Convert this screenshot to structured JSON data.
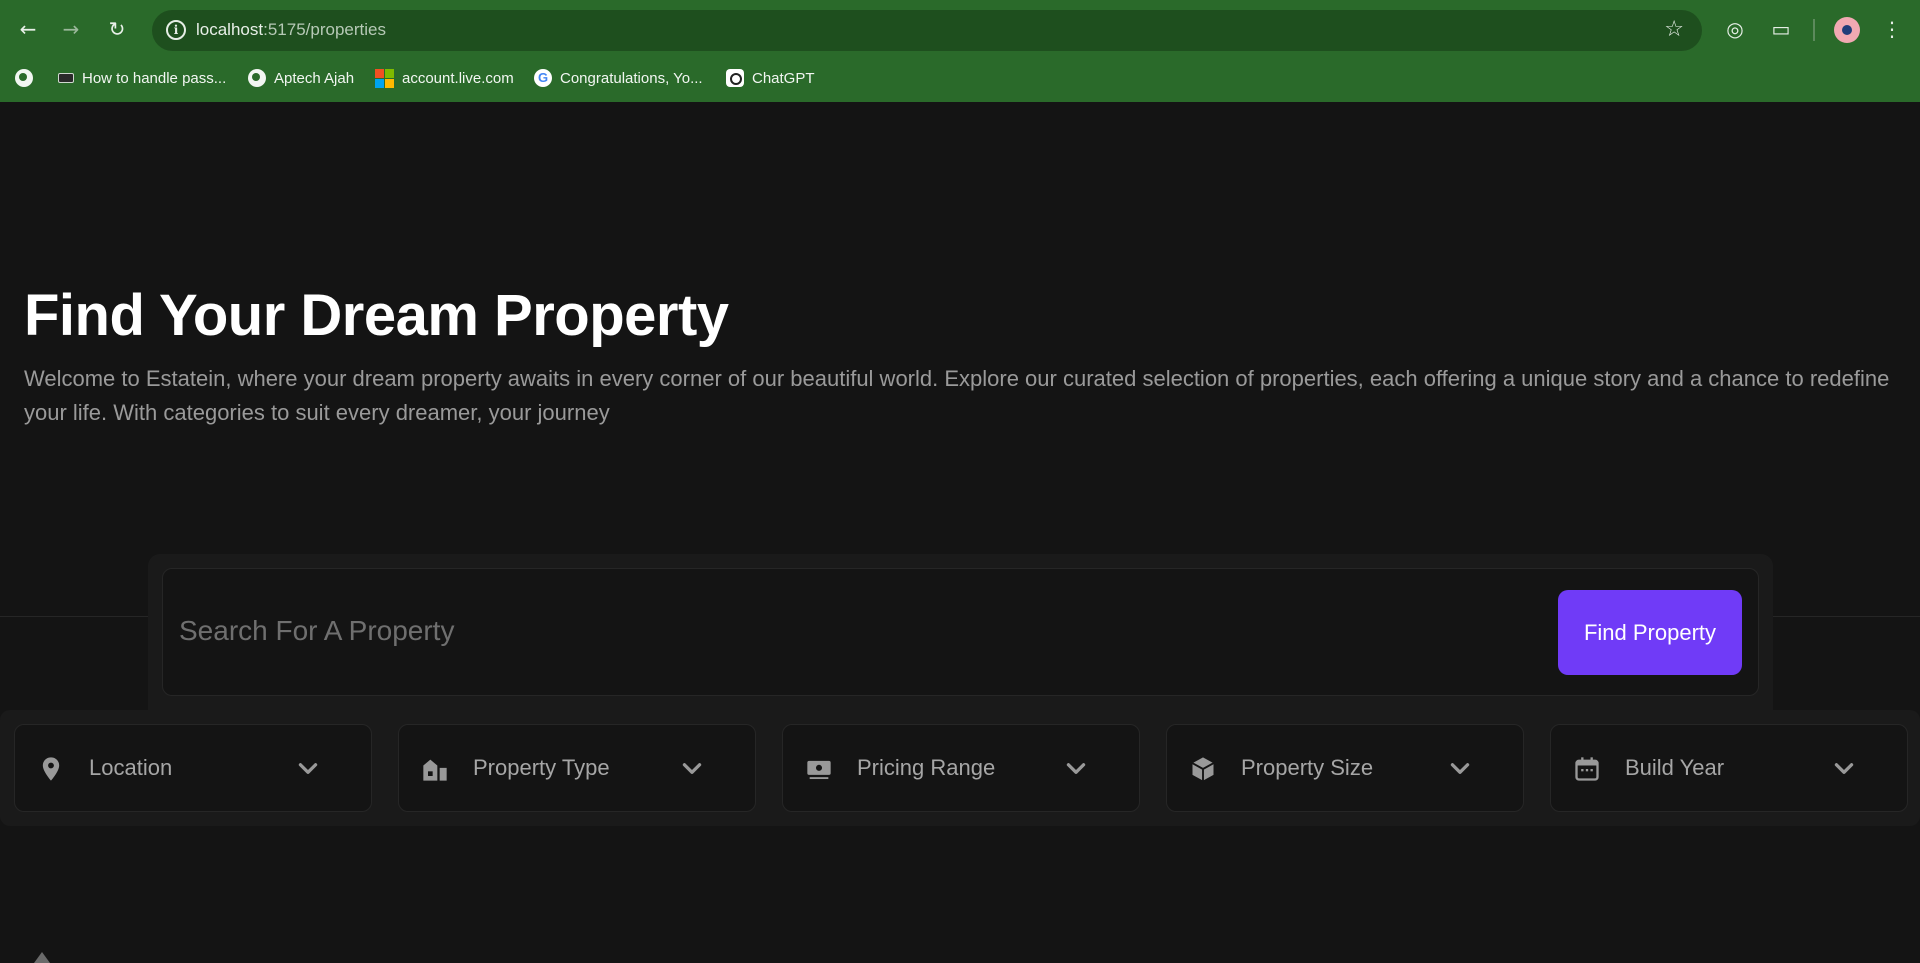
{
  "browser": {
    "url_host": "localhost",
    "url_path": ":5175/properties",
    "bookmarks": [
      {
        "label": ""
      },
      {
        "label": "How to handle pass..."
      },
      {
        "label": "Aptech Ajah"
      },
      {
        "label": "account.live.com"
      },
      {
        "label": "Congratulations, Yo..."
      },
      {
        "label": "ChatGPT"
      }
    ]
  },
  "hero": {
    "title": "Find Your Dream Property",
    "description": "Welcome to Estatein, where your dream property awaits in every corner of our beautiful world. Explore our curated selection of properties, each offering a unique story and a chance to redefine your life. With categories to suit every dreamer, your journey"
  },
  "search": {
    "placeholder": "Search For A Property",
    "button_label": "Find Property"
  },
  "filters": [
    {
      "label": "Location",
      "icon": "location-pin-icon"
    },
    {
      "label": "Property Type",
      "icon": "building-icon"
    },
    {
      "label": "Pricing Range",
      "icon": "money-icon"
    },
    {
      "label": "Property Size",
      "icon": "cube-icon"
    },
    {
      "label": "Build Year",
      "icon": "calendar-icon"
    }
  ],
  "colors": {
    "accent": "#703bf7",
    "chrome": "#2a6a2a",
    "background": "#141414"
  }
}
